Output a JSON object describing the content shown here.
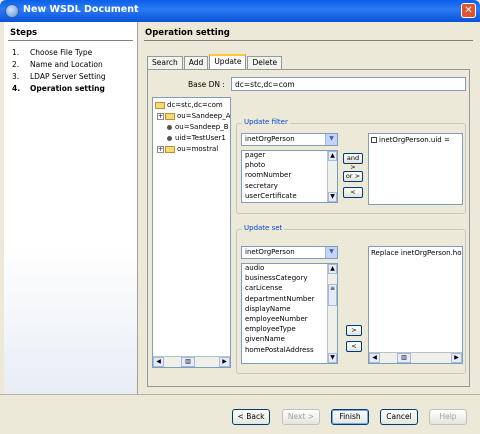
{
  "window": {
    "title": "New WSDL Document",
    "close_glyph": "✕"
  },
  "steps": {
    "header": "Steps",
    "items": [
      {
        "num": "1.",
        "label": "Choose File Type"
      },
      {
        "num": "2.",
        "label": "Name and Location"
      },
      {
        "num": "3.",
        "label": "LDAP Server Setting"
      },
      {
        "num": "4.",
        "label": "Operation setting"
      }
    ],
    "active_index": 3
  },
  "main": {
    "header": "Operation setting",
    "tabs": [
      "Search",
      "Add",
      "Update",
      "Delete"
    ],
    "active_tab": "Update",
    "base_dn_label": "Base DN :",
    "base_dn_value": "dc=stc,dc=com",
    "tree": {
      "root": "dc=stc,dc=com",
      "nodes": [
        "ou=Sandeep_A",
        "ou=Sandeep_B",
        "uid=TestUser1",
        "ou=mostral"
      ]
    },
    "update_filter": {
      "legend": "Update filter",
      "object_class": "inetOrgPerson",
      "attributes": [
        "pager",
        "photo",
        "roomNumber",
        "secretary",
        "userCertificate"
      ],
      "buttons": {
        "and": "and >",
        "or": "or >",
        "remove": "<"
      },
      "filter_text": "inetOrgPerson.uid ="
    },
    "update_set": {
      "legend": "Update set",
      "object_class": "inetOrgPerson",
      "attributes": [
        "audio",
        "businessCategory",
        "carLicense",
        "departmentNumber",
        "displayName",
        "employeeNumber",
        "employeeType",
        "givenName",
        "homePostalAddress"
      ],
      "buttons": {
        "add": ">",
        "remove": "<"
      },
      "set_text": "Replace inetOrgPerson.home"
    }
  },
  "footer": {
    "back": "< Back",
    "next": "Next >",
    "finish": "Finish",
    "cancel": "Cancel",
    "help": "Help"
  },
  "colors": {
    "titlebar": "#0a5ee8",
    "tab_highlight": "#ffc83c",
    "legend_text": "#0046d5"
  }
}
